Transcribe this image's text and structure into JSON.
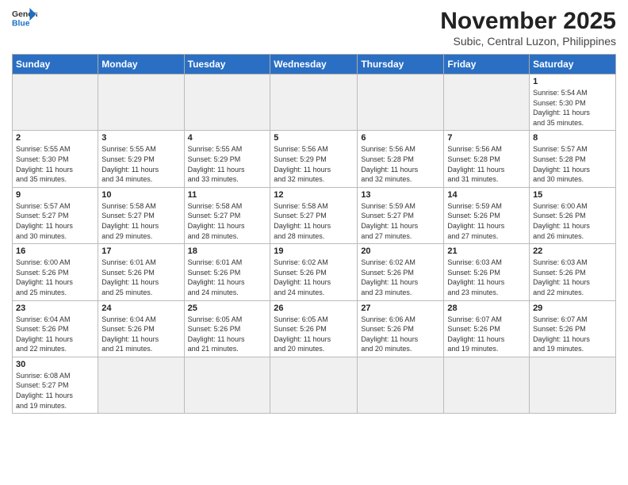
{
  "header": {
    "logo_general": "General",
    "logo_blue": "Blue",
    "month_title": "November 2025",
    "subtitle": "Subic, Central Luzon, Philippines"
  },
  "weekdays": [
    "Sunday",
    "Monday",
    "Tuesday",
    "Wednesday",
    "Thursday",
    "Friday",
    "Saturday"
  ],
  "weeks": [
    [
      {
        "day": "",
        "info": ""
      },
      {
        "day": "",
        "info": ""
      },
      {
        "day": "",
        "info": ""
      },
      {
        "day": "",
        "info": ""
      },
      {
        "day": "",
        "info": ""
      },
      {
        "day": "",
        "info": ""
      },
      {
        "day": "1",
        "info": "Sunrise: 5:54 AM\nSunset: 5:30 PM\nDaylight: 11 hours\nand 35 minutes."
      }
    ],
    [
      {
        "day": "2",
        "info": "Sunrise: 5:55 AM\nSunset: 5:30 PM\nDaylight: 11 hours\nand 35 minutes."
      },
      {
        "day": "3",
        "info": "Sunrise: 5:55 AM\nSunset: 5:29 PM\nDaylight: 11 hours\nand 34 minutes."
      },
      {
        "day": "4",
        "info": "Sunrise: 5:55 AM\nSunset: 5:29 PM\nDaylight: 11 hours\nand 33 minutes."
      },
      {
        "day": "5",
        "info": "Sunrise: 5:56 AM\nSunset: 5:29 PM\nDaylight: 11 hours\nand 32 minutes."
      },
      {
        "day": "6",
        "info": "Sunrise: 5:56 AM\nSunset: 5:28 PM\nDaylight: 11 hours\nand 32 minutes."
      },
      {
        "day": "7",
        "info": "Sunrise: 5:56 AM\nSunset: 5:28 PM\nDaylight: 11 hours\nand 31 minutes."
      },
      {
        "day": "8",
        "info": "Sunrise: 5:57 AM\nSunset: 5:28 PM\nDaylight: 11 hours\nand 30 minutes."
      }
    ],
    [
      {
        "day": "9",
        "info": "Sunrise: 5:57 AM\nSunset: 5:27 PM\nDaylight: 11 hours\nand 30 minutes."
      },
      {
        "day": "10",
        "info": "Sunrise: 5:58 AM\nSunset: 5:27 PM\nDaylight: 11 hours\nand 29 minutes."
      },
      {
        "day": "11",
        "info": "Sunrise: 5:58 AM\nSunset: 5:27 PM\nDaylight: 11 hours\nand 28 minutes."
      },
      {
        "day": "12",
        "info": "Sunrise: 5:58 AM\nSunset: 5:27 PM\nDaylight: 11 hours\nand 28 minutes."
      },
      {
        "day": "13",
        "info": "Sunrise: 5:59 AM\nSunset: 5:27 PM\nDaylight: 11 hours\nand 27 minutes."
      },
      {
        "day": "14",
        "info": "Sunrise: 5:59 AM\nSunset: 5:26 PM\nDaylight: 11 hours\nand 27 minutes."
      },
      {
        "day": "15",
        "info": "Sunrise: 6:00 AM\nSunset: 5:26 PM\nDaylight: 11 hours\nand 26 minutes."
      }
    ],
    [
      {
        "day": "16",
        "info": "Sunrise: 6:00 AM\nSunset: 5:26 PM\nDaylight: 11 hours\nand 25 minutes."
      },
      {
        "day": "17",
        "info": "Sunrise: 6:01 AM\nSunset: 5:26 PM\nDaylight: 11 hours\nand 25 minutes."
      },
      {
        "day": "18",
        "info": "Sunrise: 6:01 AM\nSunset: 5:26 PM\nDaylight: 11 hours\nand 24 minutes."
      },
      {
        "day": "19",
        "info": "Sunrise: 6:02 AM\nSunset: 5:26 PM\nDaylight: 11 hours\nand 24 minutes."
      },
      {
        "day": "20",
        "info": "Sunrise: 6:02 AM\nSunset: 5:26 PM\nDaylight: 11 hours\nand 23 minutes."
      },
      {
        "day": "21",
        "info": "Sunrise: 6:03 AM\nSunset: 5:26 PM\nDaylight: 11 hours\nand 23 minutes."
      },
      {
        "day": "22",
        "info": "Sunrise: 6:03 AM\nSunset: 5:26 PM\nDaylight: 11 hours\nand 22 minutes."
      }
    ],
    [
      {
        "day": "23",
        "info": "Sunrise: 6:04 AM\nSunset: 5:26 PM\nDaylight: 11 hours\nand 22 minutes."
      },
      {
        "day": "24",
        "info": "Sunrise: 6:04 AM\nSunset: 5:26 PM\nDaylight: 11 hours\nand 21 minutes."
      },
      {
        "day": "25",
        "info": "Sunrise: 6:05 AM\nSunset: 5:26 PM\nDaylight: 11 hours\nand 21 minutes."
      },
      {
        "day": "26",
        "info": "Sunrise: 6:05 AM\nSunset: 5:26 PM\nDaylight: 11 hours\nand 20 minutes."
      },
      {
        "day": "27",
        "info": "Sunrise: 6:06 AM\nSunset: 5:26 PM\nDaylight: 11 hours\nand 20 minutes."
      },
      {
        "day": "28",
        "info": "Sunrise: 6:07 AM\nSunset: 5:26 PM\nDaylight: 11 hours\nand 19 minutes."
      },
      {
        "day": "29",
        "info": "Sunrise: 6:07 AM\nSunset: 5:26 PM\nDaylight: 11 hours\nand 19 minutes."
      }
    ],
    [
      {
        "day": "30",
        "info": "Sunrise: 6:08 AM\nSunset: 5:27 PM\nDaylight: 11 hours\nand 19 minutes."
      },
      {
        "day": "",
        "info": ""
      },
      {
        "day": "",
        "info": ""
      },
      {
        "day": "",
        "info": ""
      },
      {
        "day": "",
        "info": ""
      },
      {
        "day": "",
        "info": ""
      },
      {
        "day": "",
        "info": ""
      }
    ]
  ]
}
